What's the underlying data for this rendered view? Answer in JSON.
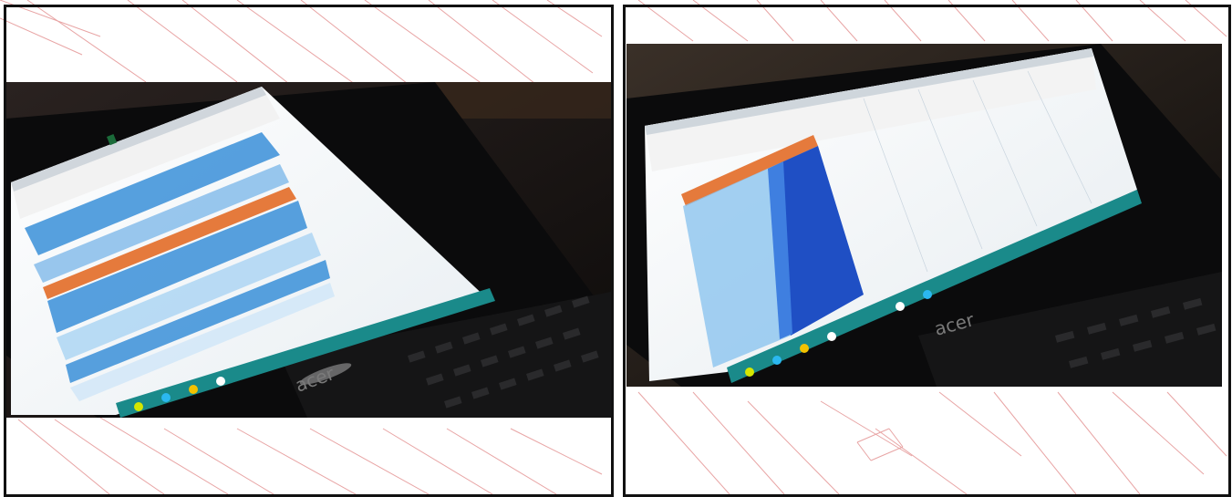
{
  "page": {
    "background_color": "#ffffff",
    "pattern_color": "#e8a4a4",
    "frame_color": "#111111"
  },
  "photos": [
    {
      "subject": "laptop-showing-spreadsheet-with-blue-rows",
      "brand_label": "acer",
      "screen_colors": {
        "header": "#e57a3c",
        "cells": "#3a8fd8",
        "taskbar": "#1a8a8a"
      }
    },
    {
      "subject": "laptop-showing-spreadsheet-with-blue-column",
      "brand_label": "acer",
      "screen_colors": {
        "header": "#e57a3c",
        "cells": "#1f4fc4",
        "taskbar": "#1a8a8a"
      }
    }
  ]
}
